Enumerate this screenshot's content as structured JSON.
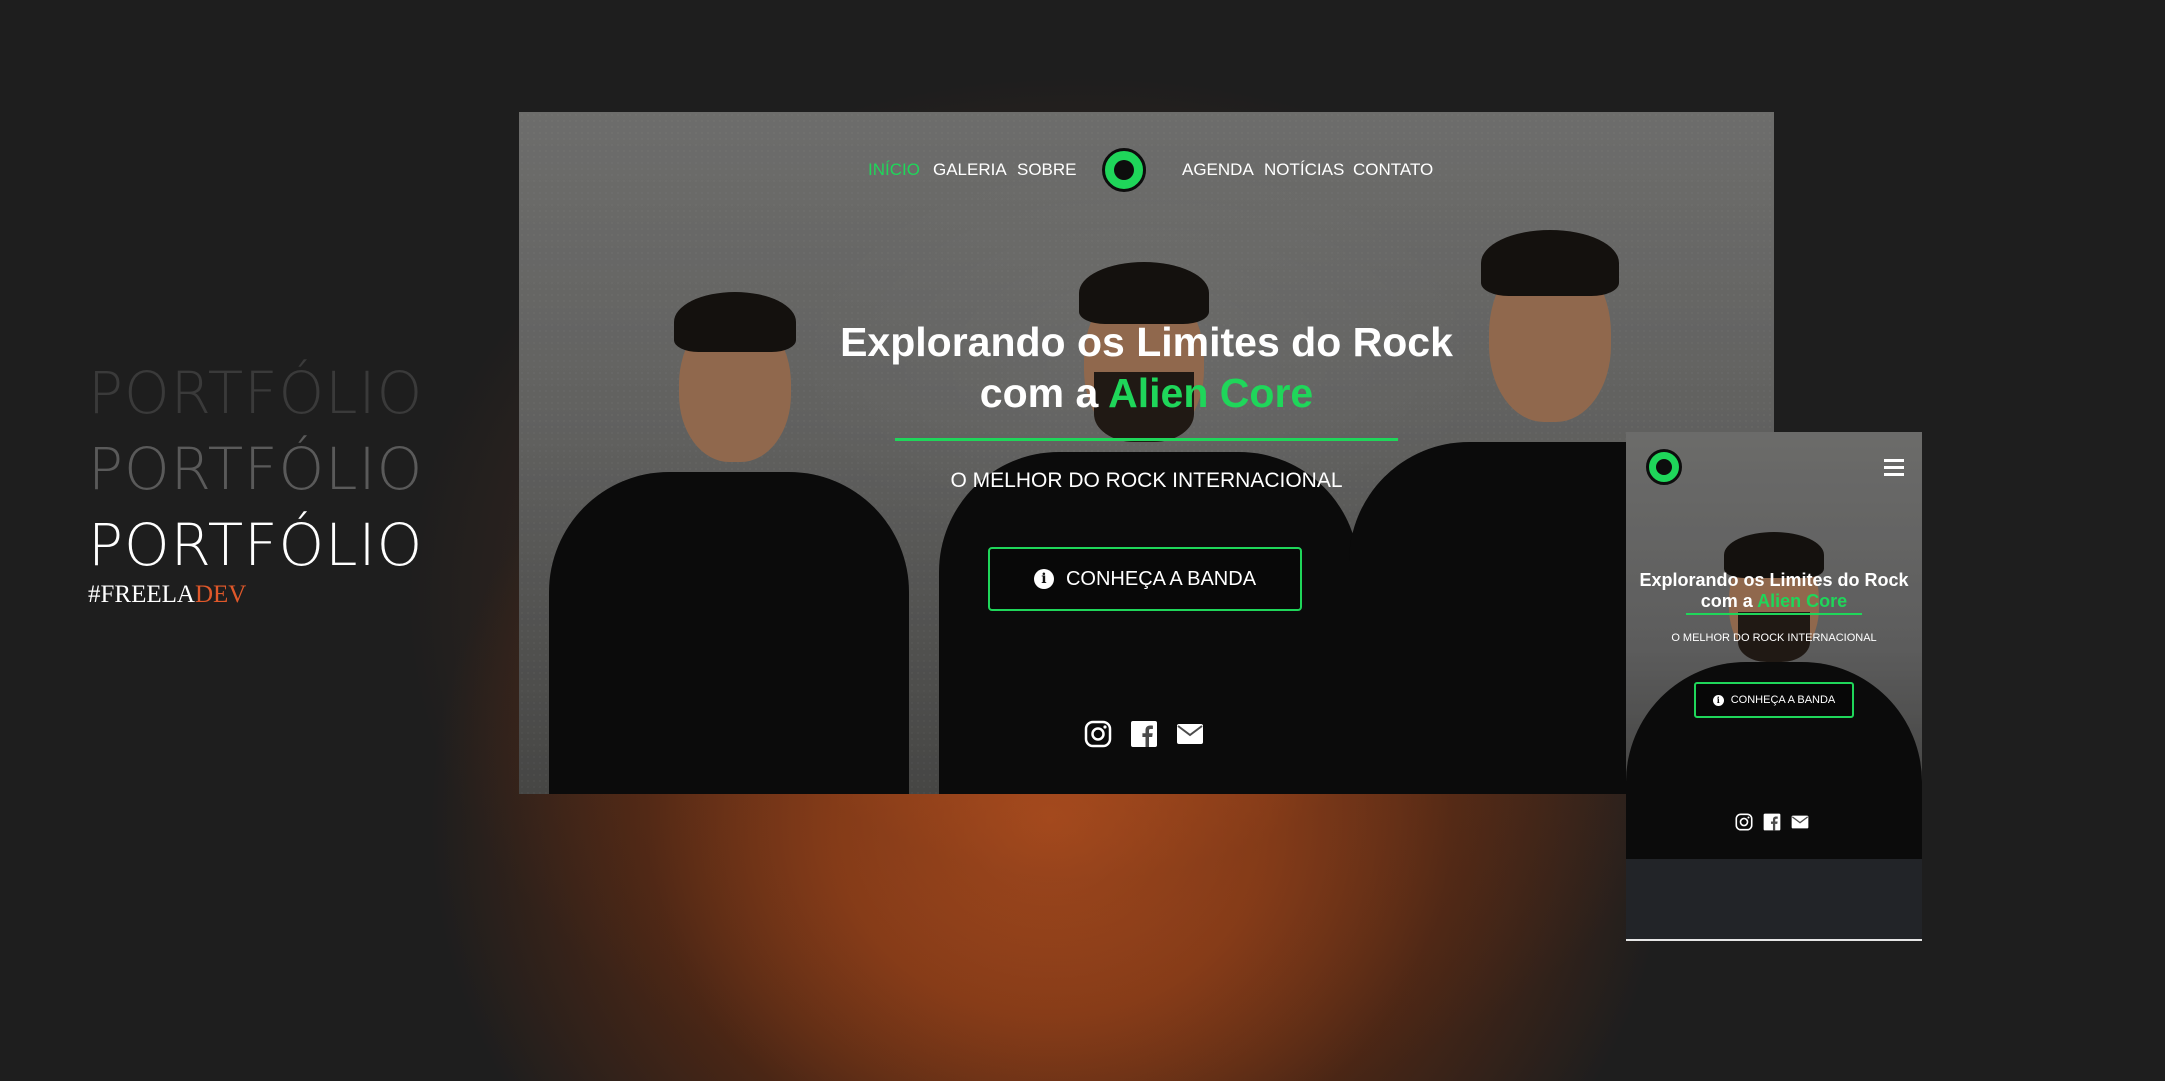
{
  "portfolio": {
    "lines": [
      "PORTFÓLIO",
      "PORTFÓLIO",
      "PORTFÓLIO"
    ],
    "tag_prefix": "#FREELA",
    "tag_suffix": "DEV"
  },
  "desktop": {
    "nav_left": [
      "INÍCIO",
      "GALERIA",
      "SOBRE"
    ],
    "nav_right": [
      "AGENDA",
      "NOTÍCIAS",
      "CONTATO"
    ],
    "hero_title_line1": "Explorando os Limites do Rock",
    "hero_title_line2_prefix": "com a ",
    "hero_title_accent": "Alien Core",
    "hero_subtitle": "O MELHOR DO ROCK INTERNACIONAL",
    "cta_label": "CONHEÇA A BANDA",
    "socials": [
      "instagram-icon",
      "facebook-icon",
      "envelope-icon"
    ]
  },
  "mobile": {
    "hero_title_line1": "Explorando os Limites do Rock",
    "hero_title_line2_prefix": "com a ",
    "hero_title_accent": "Alien Core",
    "hero_subtitle": "O MELHOR DO ROCK INTERNACIONAL",
    "cta_label": "CONHEÇA A BANDA"
  },
  "colors": {
    "accent_green": "#1fd65a",
    "dev_orange": "#e0582a",
    "background_dark": "#1e1e1e",
    "glow_orange": "#b4501f"
  }
}
